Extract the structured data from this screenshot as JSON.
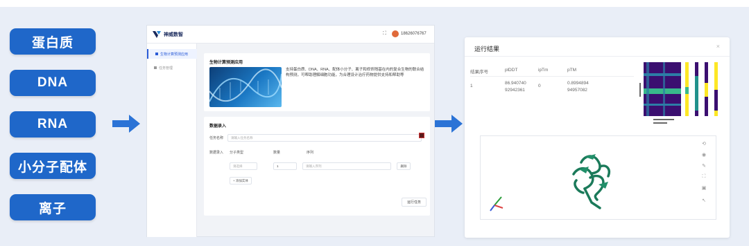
{
  "left_pills": [
    {
      "label": "蛋白质"
    },
    {
      "label": "DNA"
    },
    {
      "label": "RNA"
    },
    {
      "label": "小分子配体"
    },
    {
      "label": "离子"
    }
  ],
  "app": {
    "brand": "神威数智",
    "phone": "18626076767",
    "sidebar": [
      {
        "label": "生物计算预测应用",
        "active": true
      },
      {
        "label": "任务管理",
        "active": false
      }
    ],
    "intro": {
      "title": "生物计算预测应用",
      "desc": "支持蛋白质、DNA、RNA、配体小分子、离子和修饰残基在内的复合生物的联合结构预测，可帮助理解细胞功能，为合理设计治疗药物提供支持和帮助等"
    },
    "form": {
      "title": "数据录入",
      "task_name_label": "任务名称",
      "task_name_placeholder": "请输入任务名称",
      "data_entry_label": "数据录入",
      "col_type": "分子类型",
      "col_count": "数量",
      "col_seq": "序列",
      "select_placeholder": "请选择",
      "count_value": "1",
      "seq_placeholder": "请输入序列",
      "delete_label": "删除",
      "add_entity_label": "+ 添加实体",
      "run_label": "运行任务"
    }
  },
  "result": {
    "title": "运行结果",
    "close": "×",
    "headers": [
      "结果序号",
      "plDDT",
      "ipTm",
      "pTM"
    ],
    "row": {
      "index": "1",
      "plddt_line1": "86.940740",
      "plddt_line2": "92942361",
      "iptm": "0",
      "ptm_line1": "0.8994894",
      "ptm_line2": "94957082"
    }
  },
  "colors": {
    "pill": "#1f67c9",
    "arrow": "#2b73d6",
    "protein": "#1b7a5a",
    "accent": "#2a5bd7"
  }
}
